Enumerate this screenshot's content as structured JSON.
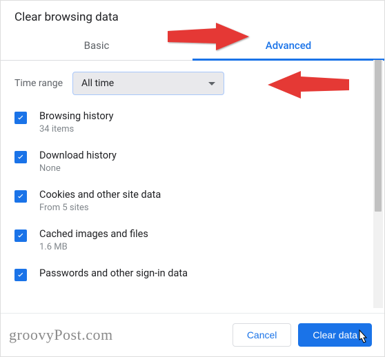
{
  "title": "Clear browsing data",
  "tabs": {
    "basic": "Basic",
    "advanced": "Advanced"
  },
  "timeRange": {
    "label": "Time range",
    "value": "All time"
  },
  "items": [
    {
      "label": "Browsing history",
      "sub": "34 items"
    },
    {
      "label": "Download history",
      "sub": "None"
    },
    {
      "label": "Cookies and other site data",
      "sub": "From 5 sites"
    },
    {
      "label": "Cached images and files",
      "sub": "1.6 MB"
    },
    {
      "label": "Passwords and other sign-in data",
      "sub": ""
    }
  ],
  "buttons": {
    "cancel": "Cancel",
    "clear": "Clear data"
  },
  "watermark": "groovyPost.com"
}
